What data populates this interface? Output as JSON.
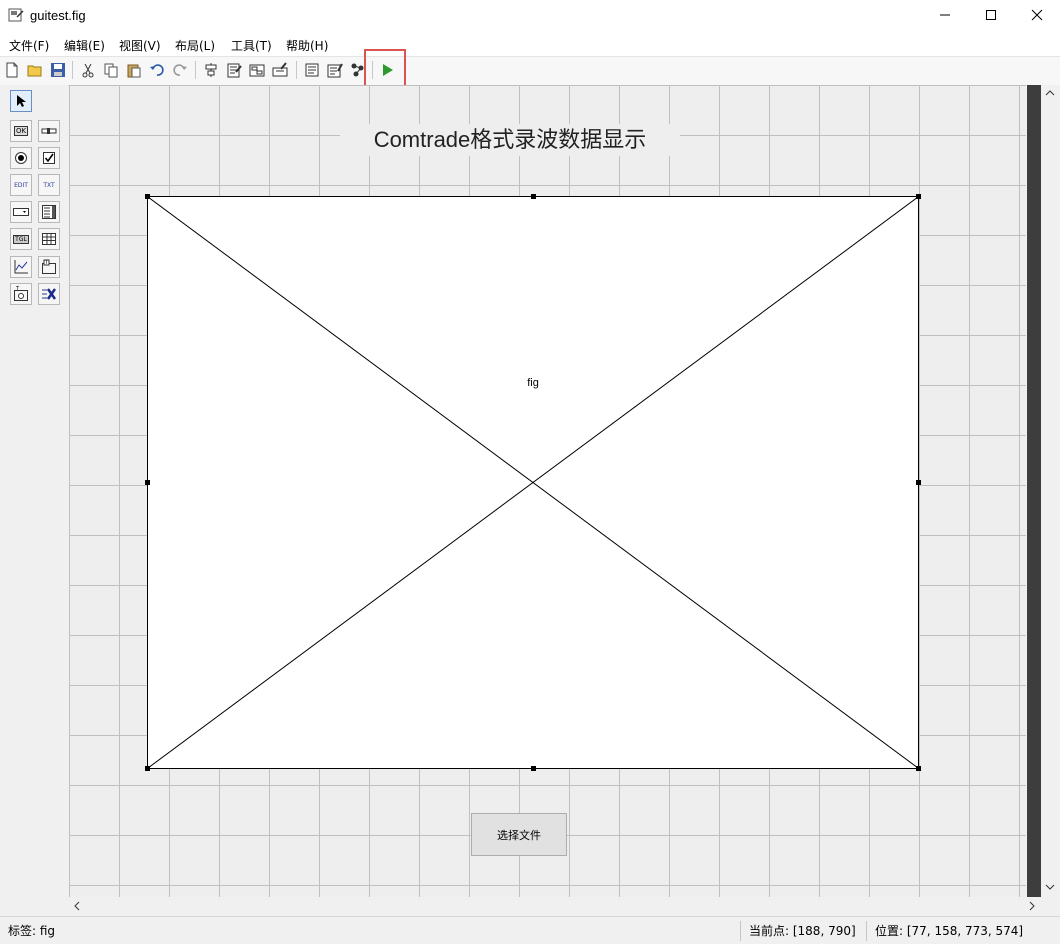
{
  "window": {
    "title": "guitest.fig"
  },
  "menu": [
    "文件(F)",
    "编辑(E)",
    "视图(V)",
    "布局(L)",
    "工具(T)",
    "帮助(H)"
  ],
  "toolbar": {
    "icons": [
      "new-file-icon",
      "open-folder-icon",
      "save-icon",
      "cut-icon",
      "copy-icon",
      "paste-icon",
      "undo-icon",
      "redo-icon",
      "align-icon",
      "menu-editor-icon",
      "tab-order-icon",
      "toolbar-editor-icon",
      "mfile-editor-icon",
      "property-inspector-icon",
      "object-browser-icon",
      "run-icon"
    ],
    "accent_run": "#2e9a2e",
    "highlight_color": "#d9534f"
  },
  "palette": {
    "tools": [
      "select-tool",
      "push-button-tool",
      "slider-tool",
      "radio-button-tool",
      "checkbox-tool",
      "edit-text-tool",
      "static-text-tool",
      "popup-menu-tool",
      "listbox-tool",
      "toggle-button-tool",
      "table-tool",
      "axes-tool",
      "panel-tool",
      "button-group-tool",
      "activex-tool"
    ],
    "labels": {
      "ok": "OK",
      "edit": "EDIT",
      "txt": "TXT",
      "tgl": "TGL"
    }
  },
  "canvas": {
    "title": "Comtrade格式录波数据显示",
    "axes_tag": "fig",
    "button_label": "选择文件"
  },
  "status": {
    "tag": "标签: fig",
    "current_point": "当前点:  [188, 790]",
    "position": "位置: [77, 158, 773, 574]"
  }
}
